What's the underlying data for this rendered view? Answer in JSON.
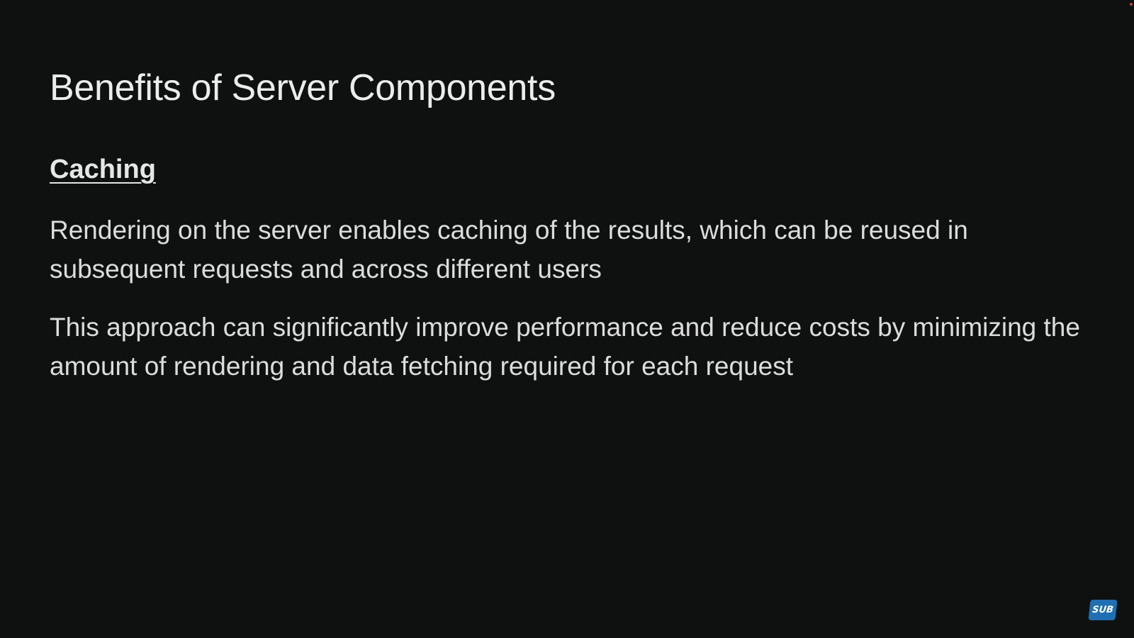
{
  "slide": {
    "title": "Benefits of Server Components",
    "section_heading": "Caching",
    "paragraphs": [
      "Rendering on the server enables caching of the results, which can be reused in subsequent requests and across different users",
      "This approach can significantly improve performance and reduce costs by minimizing the amount of rendering and data fetching required for each request"
    ]
  },
  "badge": {
    "label": "SUB",
    "icon": "subscribe-badge-icon",
    "color": "#1f6fb2"
  },
  "colors": {
    "background": "#0f1111",
    "text": "#e4e4e4"
  }
}
